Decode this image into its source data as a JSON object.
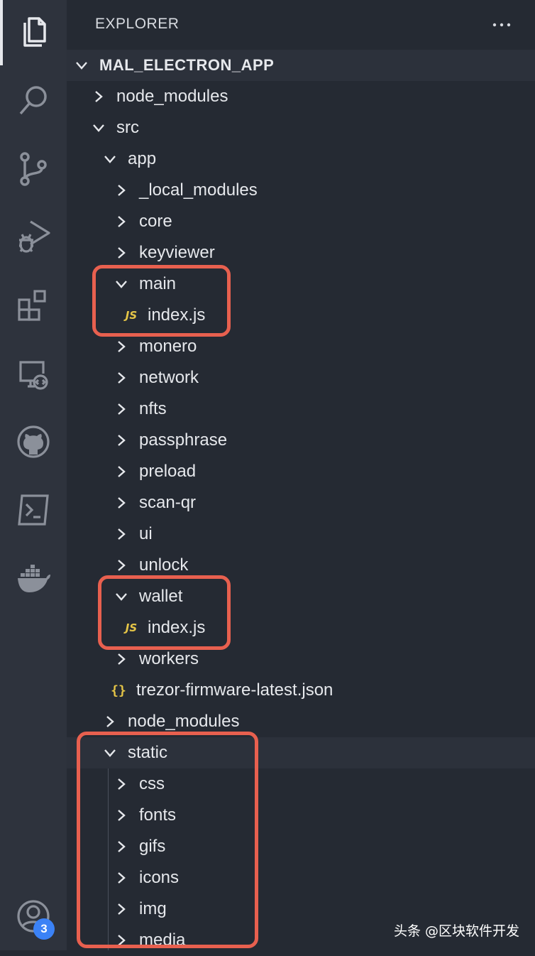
{
  "explorer": {
    "header": "EXPLORER",
    "project_name": "MAL_ELECTRON_APP"
  },
  "tree": {
    "node_modules_root": "node_modules",
    "src": "src",
    "app": "app",
    "local_modules": "_local_modules",
    "core": "core",
    "keyviewer": "keyviewer",
    "main": "main",
    "main_index": "index.js",
    "monero": "monero",
    "network": "network",
    "nfts": "nfts",
    "passphrase": "passphrase",
    "preload": "preload",
    "scan_qr": "scan-qr",
    "ui": "ui",
    "unlock": "unlock",
    "wallet": "wallet",
    "wallet_index": "index.js",
    "workers": "workers",
    "trezor_json": "trezor-firmware-latest.json",
    "node_modules_src": "node_modules",
    "static": "static",
    "css": "css",
    "fonts": "fonts",
    "gifs": "gifs",
    "icons": "icons",
    "img": "img",
    "media": "media"
  },
  "file_icons": {
    "js": "JS",
    "json": "{}"
  },
  "accounts_badge": "3",
  "watermark": "头条 @区块软件开发",
  "colors": {
    "highlight_box": "#e8604f",
    "js_icon": "#e5c547",
    "badge": "#3b82f6",
    "background": "#252a33"
  }
}
